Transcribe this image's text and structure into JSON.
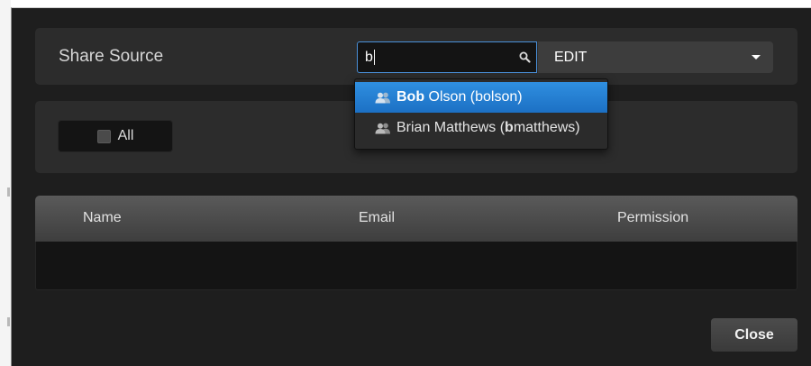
{
  "share": {
    "title": "Share Source",
    "search_value": "b",
    "permission_value": "EDIT"
  },
  "suggestions": [
    {
      "match": "B",
      "label": "ob Olson (bolson)",
      "match_prefix": "Bob",
      "rest": " Olson (bolson)",
      "active": true
    },
    {
      "match": "b",
      "label": "Brian Matthews (",
      "match_prefix": "b",
      "rest": "matthews)",
      "active": false
    }
  ],
  "filter": {
    "all_label": "All",
    "all_checked": false
  },
  "table": {
    "columns": [
      "Name",
      "Email",
      "Permission"
    ]
  },
  "footer": {
    "close_label": "Close"
  },
  "colors": {
    "accent": "#2a84d6",
    "dialog_bg": "#1e1e1e",
    "panel_bg": "#2c2c2c"
  },
  "icons": {
    "search": "search-icon",
    "caret": "chevron-down-icon",
    "users": "users-icon"
  }
}
